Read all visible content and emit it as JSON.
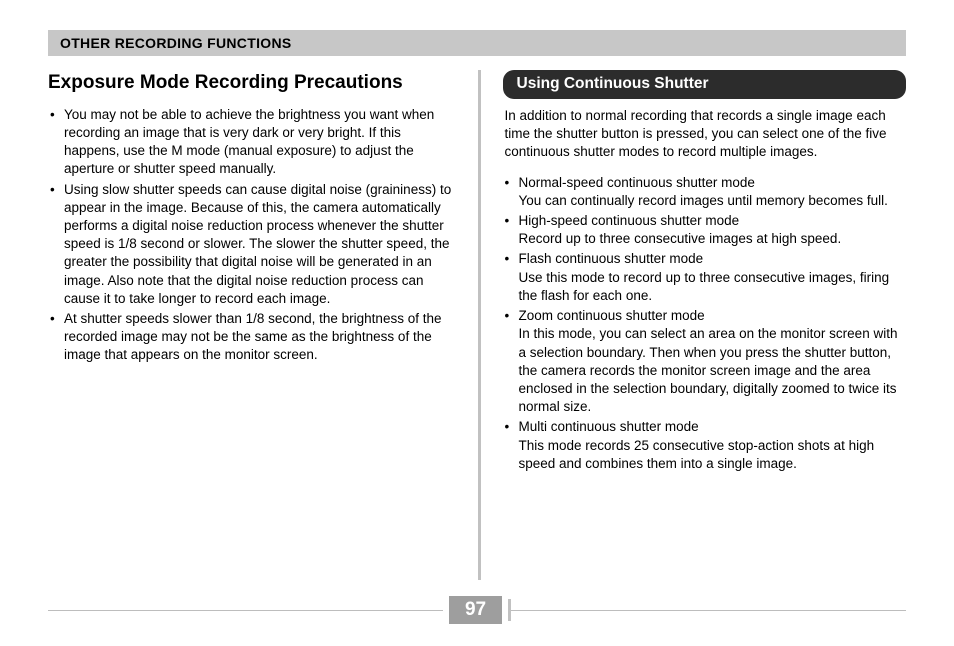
{
  "section_header": "OTHER RECORDING FUNCTIONS",
  "page_number": "97",
  "left": {
    "title": "Exposure Mode Recording Precautions",
    "bullets": [
      "You may not be able to achieve the brightness you want when recording an image that is very dark or very bright. If this happens, use the M mode (manual exposure) to adjust the aperture or shutter speed manually.",
      "Using slow shutter speeds can cause digital noise (graininess) to appear in the image. Because of this, the camera automatically performs a digital noise reduction process whenever the shutter speed is 1/8 second or slower. The slower the shutter speed, the greater the possibility that digital noise will be generated in an image. Also note that the digital noise reduction process can cause it to take longer to record each image.",
      "At shutter speeds slower than 1/8 second, the brightness of the recorded image may not be the same as the brightness of the image that appears on the monitor screen."
    ]
  },
  "right": {
    "title": "Using Continuous Shutter",
    "intro": "In addition to normal recording that records a single image each time the shutter button is pressed, you can select one of the five continuous shutter modes to record multiple images.",
    "modes": [
      {
        "name": "Normal-speed continuous shutter mode",
        "desc": "You can continually record images until memory becomes full."
      },
      {
        "name": "High-speed continuous shutter mode",
        "desc": "Record up to three consecutive images at high speed."
      },
      {
        "name": "Flash continuous shutter mode",
        "desc": "Use this mode to record up to three consecutive images, firing the flash for each one."
      },
      {
        "name": "Zoom continuous shutter mode",
        "desc": "In this mode, you can select an area on the monitor screen with a selection boundary. Then when you press the shutter button, the camera records the monitor screen image and the area enclosed in the selection boundary, digitally zoomed to twice its normal size."
      },
      {
        "name": "Multi continuous shutter mode",
        "desc": "This mode records 25 consecutive stop-action shots at high speed and combines them into a single image."
      }
    ]
  }
}
